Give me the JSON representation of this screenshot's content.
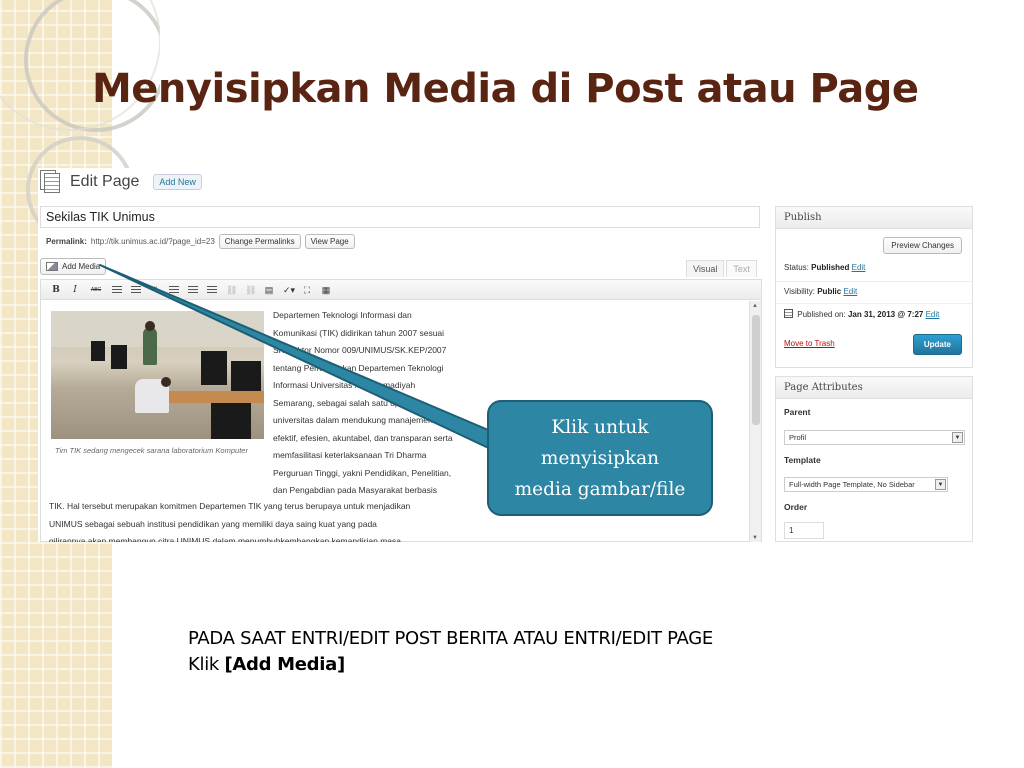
{
  "slide": {
    "title": "Menyisipkan Media di Post atau Page",
    "instruction_line1": "PADA SAAT ENTRI/EDIT POST BERITA ATAU ENTRI/EDIT PAGE",
    "instruction_prefix": "Klik ",
    "instruction_bold": "[Add Media]"
  },
  "callout": {
    "line1": "Klik  untuk",
    "line2": "menyisipkan",
    "line3": "media gambar/file"
  },
  "editor": {
    "heading": "Edit Page",
    "add_new_label": "Add New",
    "title_value": "Sekilas TIK Unimus",
    "permalink_label": "Permalink:",
    "permalink_url": "http://tik.unimus.ac.id/?page_id=23",
    "change_permalinks_label": "Change Permalinks",
    "view_page_label": "View Page",
    "add_media_label": "Add Media",
    "tab_visual": "Visual",
    "tab_text": "Text",
    "image_caption": "Tim TIK sedang mengecek sarana laboratorium Komputer",
    "body_lines": [
      "Departemen Teknologi Informasi dan",
      "Komunikasi (TIK) didirikan tahun 2007 sesuai",
      "SK Rektor Nomor 009/UNIMUS/SK.KEP/2007",
      "tentang Pembentukan Departemen Teknologi",
      "Informasi Universitas Muhammadiyah",
      "Semarang, sebagai salah satu upaya",
      "universitas dalam mendukung manajemen",
      "efektif, efesien, akuntabel, dan transparan serta",
      "memfasilitasi keterlaksanaan Tri Dharma",
      "Perguruan Tinggi, yakni Pendidikan, Penelitian,",
      "dan Pengabdian pada Masyarakat berbasis"
    ],
    "body_wide_lines": [
      "TIK. Hal tersebut merupakan komitmen Departemen TIK yang terus berupaya untuk menjadikan",
      "UNIMUS sebagai sebuah institusi pendidikan yang memiliki daya saing kuat yang pada",
      "gilirannya akan membangun citra UNIMUS dalam menumbuhkembangkan kemandirian masa"
    ]
  },
  "publish": {
    "header": "Publish",
    "preview_label": "Preview Changes",
    "status_label": "Status:",
    "status_value": "Published",
    "visibility_label": "Visibility:",
    "visibility_value": "Public",
    "published_on_label": "Published on:",
    "published_on_value": "Jan 31, 2013 @ 7:27",
    "edit_label": "Edit",
    "trash_label": "Move to Trash",
    "update_label": "Update"
  },
  "attributes": {
    "header": "Page Attributes",
    "parent_label": "Parent",
    "parent_value": "Profil",
    "template_label": "Template",
    "template_value": "Full-width Page Template, No Sidebar",
    "order_label": "Order",
    "order_value": "1"
  },
  "colors": {
    "title": "#5a2413",
    "callout": "#2d86a4",
    "link": "#21759b",
    "update_button": "#21759b",
    "trash": "#bc0b0b"
  }
}
